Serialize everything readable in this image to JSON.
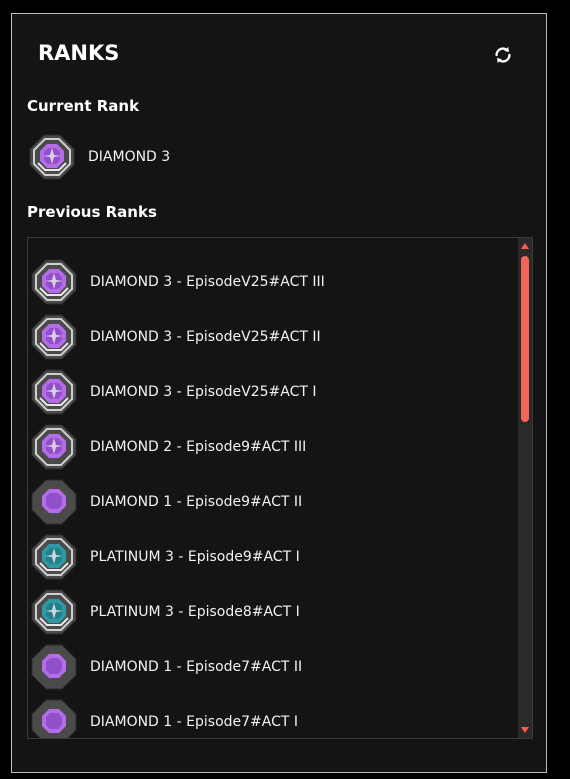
{
  "header": {
    "logo": "RANKS",
    "refresh_icon": "refresh-icon"
  },
  "current_rank": {
    "title": "Current Rank",
    "rank": "DIAMOND 3",
    "tier": "diamond3"
  },
  "previous_ranks": {
    "title": "Previous Ranks",
    "items": [
      {
        "label": "DIAMOND 3 - EpisodeV25#ACT III",
        "tier": "diamond3"
      },
      {
        "label": "DIAMOND 3 - EpisodeV25#ACT II",
        "tier": "diamond3"
      },
      {
        "label": "DIAMOND 3 - EpisodeV25#ACT I",
        "tier": "diamond3"
      },
      {
        "label": "DIAMOND 2 - Episode9#ACT III",
        "tier": "diamond2"
      },
      {
        "label": "DIAMOND 1 - Episode9#ACT II",
        "tier": "diamond1"
      },
      {
        "label": "PLATINUM 3 - Episode9#ACT I",
        "tier": "platinum3"
      },
      {
        "label": "PLATINUM 3 - Episode8#ACT I",
        "tier": "platinum3"
      },
      {
        "label": "DIAMOND 1 - Episode7#ACT II",
        "tier": "diamond1"
      },
      {
        "label": "DIAMOND 1 - Episode7#ACT I",
        "tier": "diamond1"
      }
    ]
  },
  "colors": {
    "background": "#141414",
    "accent": "#f2655a",
    "diamond": "#b56ce8",
    "platinum": "#2f9aa6"
  }
}
